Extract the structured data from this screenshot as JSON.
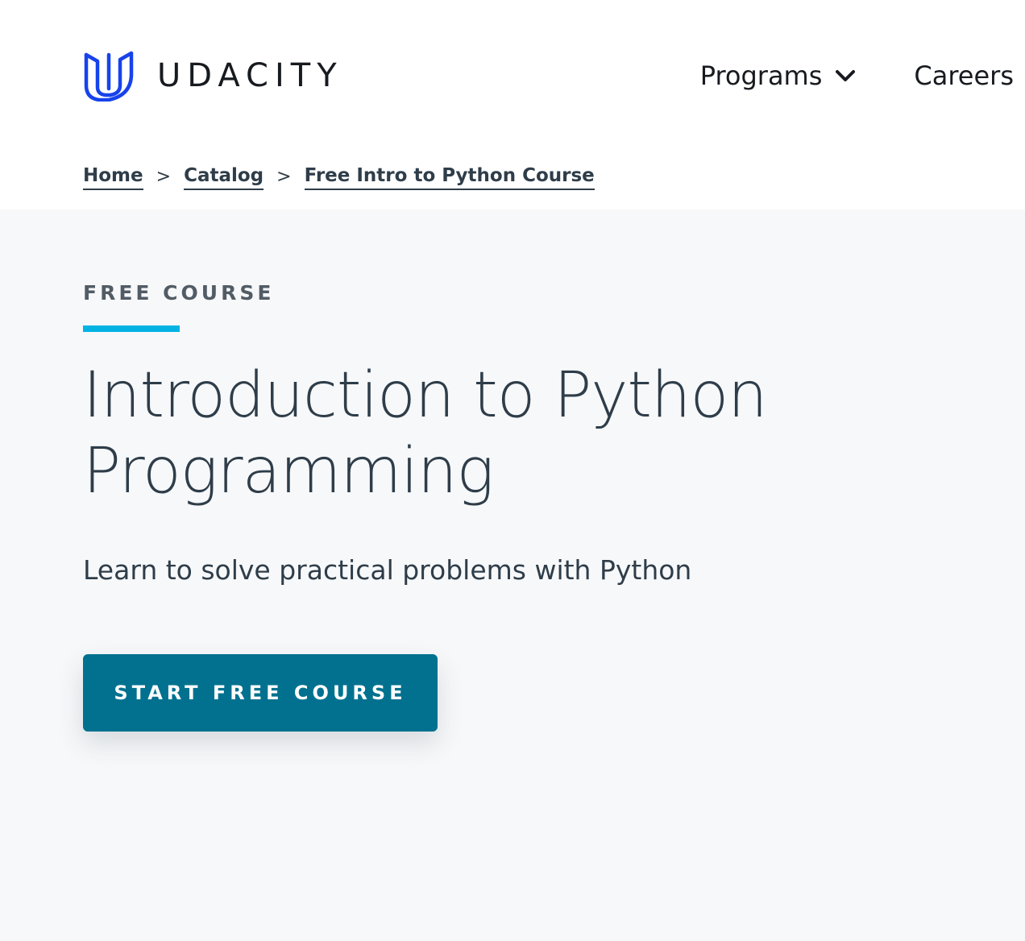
{
  "brand": {
    "name": "UDACITY",
    "logo_icon": "udacity-u-logo-icon",
    "logo_color": "#1742ec"
  },
  "nav": {
    "items": [
      {
        "label": "Programs",
        "icon": "chevron-down-icon"
      },
      {
        "label": "Careers"
      }
    ]
  },
  "breadcrumb": {
    "items": [
      "Home",
      "Catalog",
      "Free Intro to Python Course"
    ],
    "separator": ">"
  },
  "hero": {
    "eyebrow": "FREE COURSE",
    "title": "Introduction to Python Programming",
    "subtitle": "Learn to solve practical problems with Python",
    "cta_label": "START FREE COURSE",
    "accent_color": "#02b3e4",
    "cta_color": "#02718f",
    "background": "#f7f8fa"
  }
}
